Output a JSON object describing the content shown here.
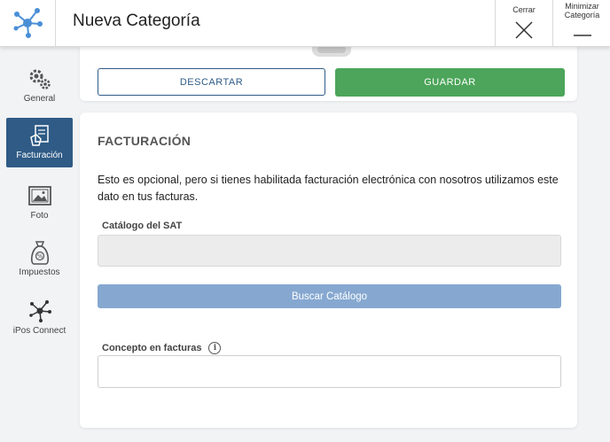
{
  "header": {
    "title": "Nueva Categoría",
    "close_label": "Cerrar",
    "minimize_label_1": "Minimizar",
    "minimize_label_2": "Categoría"
  },
  "sidebar": {
    "items": [
      {
        "label": "General",
        "icon": "gears-icon"
      },
      {
        "label": "Facturación",
        "icon": "invoice-icon",
        "active": true
      },
      {
        "label": "Foto",
        "icon": "photo-icon"
      },
      {
        "label": "Impuestos",
        "icon": "tax-bag-icon"
      },
      {
        "label": "iPos Connect",
        "icon": "network-icon"
      }
    ]
  },
  "actions": {
    "discard_label": "DESCARTAR",
    "save_label": "GUARDAR"
  },
  "billing": {
    "title": "FACTURACIÓN",
    "description": "Esto es opcional, pero si tienes habilitada facturación electrónica con nosotros utilizamos este dato en tus facturas.",
    "sat_label": "Catálogo del SAT",
    "sat_value": "",
    "search_label": "Buscar Catálogo",
    "concept_label": "Concepto en facturas",
    "concept_value": ""
  },
  "colors": {
    "brand": "#2f5b86",
    "save": "#4ca55a",
    "search": "#86a8d0"
  }
}
